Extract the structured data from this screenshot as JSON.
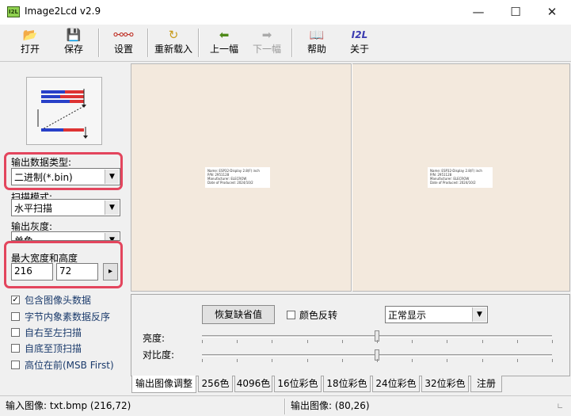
{
  "window": {
    "title": "Image2Lcd v2.9",
    "icon_text": "I2L",
    "minimize": "—",
    "maximize": "☐",
    "close": "✕"
  },
  "toolbar": {
    "open": "打开",
    "save": "保存",
    "settings": "设置",
    "reload": "重新载入",
    "prev": "上一幅",
    "next": "下一幅",
    "help": "帮助",
    "about": "关于",
    "about_icon_text": "I2L"
  },
  "left": {
    "output_type_label": "输出数据类型:",
    "output_type_value": "二进制(*.bin)",
    "scan_mode_label": "扫描模式:",
    "scan_mode_value": "水平扫描",
    "gray_label": "输出灰度:",
    "gray_value": "单色",
    "max_size_label": "最大宽度和高度",
    "max_width": "216",
    "max_height": "72",
    "arrow_btn": "▸",
    "options": [
      {
        "label": "包含图像头数据",
        "checked": true
      },
      {
        "label": "字节内象素数据反序",
        "checked": false
      },
      {
        "label": "自右至左扫描",
        "checked": false
      },
      {
        "label": "自底至顶扫描",
        "checked": false
      },
      {
        "label": "高位在前(MSB First)",
        "checked": false
      }
    ]
  },
  "preview": {
    "left_lines": [
      "Name: ESP32-Display 2.8(F) inch",
      "P/N: 2951128",
      "Manufacturer: ELECROW",
      "Date of Produced: 2024/10/2"
    ],
    "right_lines": [
      "Name: ESP32-Display 2.8(F) inch",
      "P/N: 2951128",
      "Manufacturer: ELECROW",
      "Date of Produced: 2024/10/2"
    ]
  },
  "adjust": {
    "restore_button": "恢复缺省值",
    "invert_label": "颜色反转",
    "invert_checked": false,
    "display_mode_value": "正常显示",
    "brightness_label": "亮度:",
    "contrast_label": "对比度:",
    "brightness_fraction": 0.5,
    "contrast_fraction": 0.5
  },
  "tabs": [
    "输出图像调整",
    "256色",
    "4096色",
    "16位彩色",
    "18位彩色",
    "24位彩色",
    "32位彩色",
    "注册"
  ],
  "status": {
    "input": "输入图像: txt.bmp (216,72)",
    "output": "输出图像: (80,26)"
  }
}
